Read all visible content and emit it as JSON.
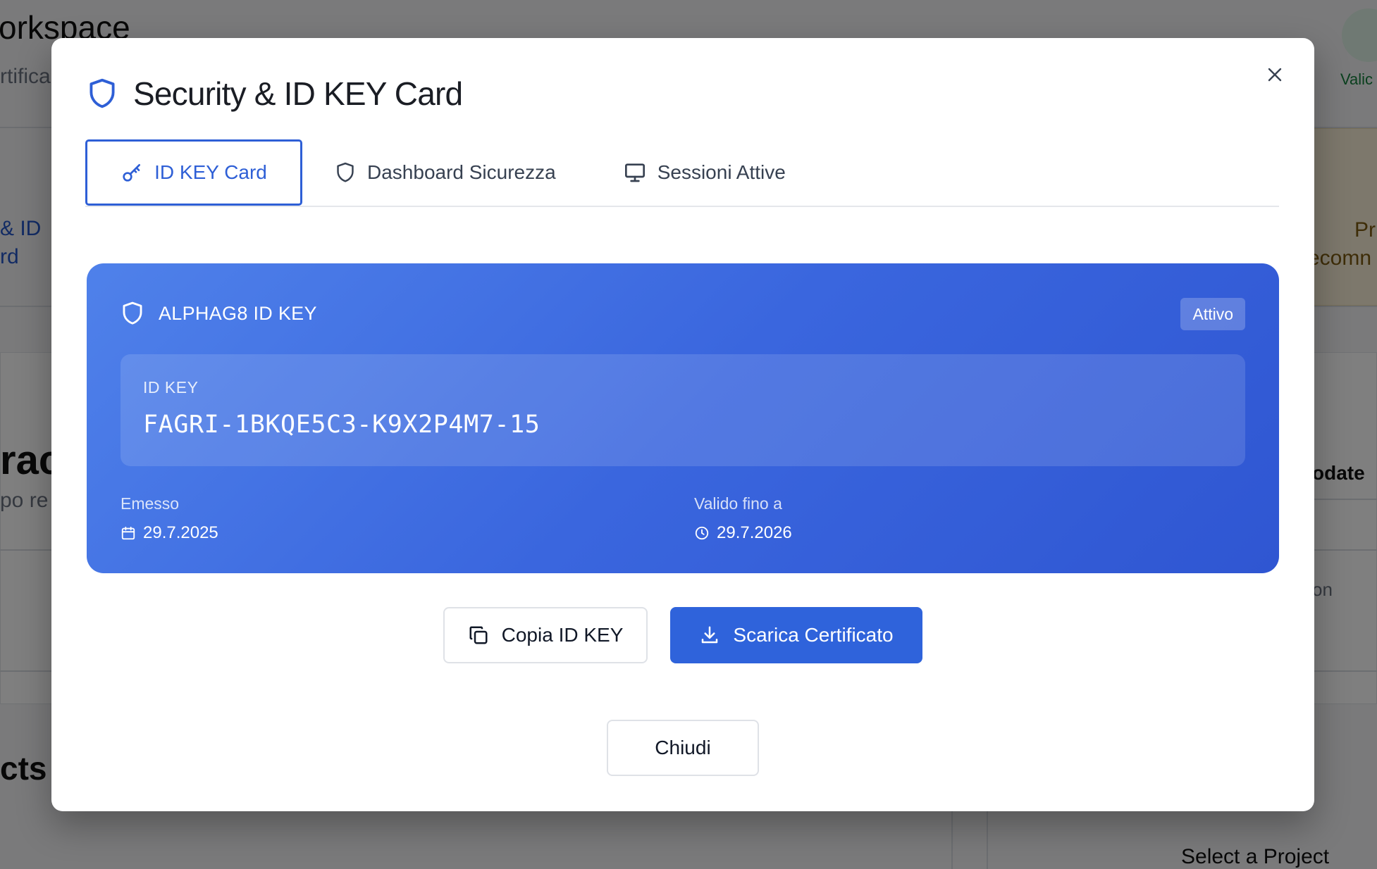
{
  "background": {
    "workspace_title": "orkspace",
    "certificate_fragment": "rtifica",
    "valid_fragment": "Valic",
    "sidebar_fragment_1": "& ID",
    "sidebar_fragment_2": "rd",
    "right_fragment_1": "Pr",
    "right_fragment_2": "ecomn",
    "section_fragment": "rac",
    "section_sub_fragment": "po re",
    "update_fragment": "odate",
    "on_fragment": "on",
    "projects_fragment": "cts C",
    "select_project": "Select a Project"
  },
  "modal": {
    "title": "Security & ID KEY Card",
    "close_icon": "close-icon",
    "tabs": [
      {
        "label": "ID KEY Card",
        "icon": "key-icon",
        "active": true
      },
      {
        "label": "Dashboard Sicurezza",
        "icon": "shield-icon",
        "active": false
      },
      {
        "label": "Sessioni Attive",
        "icon": "monitor-icon",
        "active": false
      }
    ],
    "card": {
      "heading": "ALPHAG8 ID KEY",
      "status": "Attivo",
      "key_label": "ID KEY",
      "key_value": "FAGRI-1BKQE5C3-K9X2P4M7-15",
      "issued_label": "Emesso",
      "issued_value": "29.7.2025",
      "valid_label": "Valido fino a",
      "valid_value": "29.7.2026"
    },
    "actions": {
      "copy_label": "Copia ID KEY",
      "download_label": "Scarica Certificato",
      "close_label": "Chiudi"
    }
  },
  "colors": {
    "accent": "#2e5fd6",
    "card_gradient_start": "#4f81ea",
    "card_gradient_end": "#2f56d2",
    "overlay": "rgba(0,0,0,0.5)"
  }
}
